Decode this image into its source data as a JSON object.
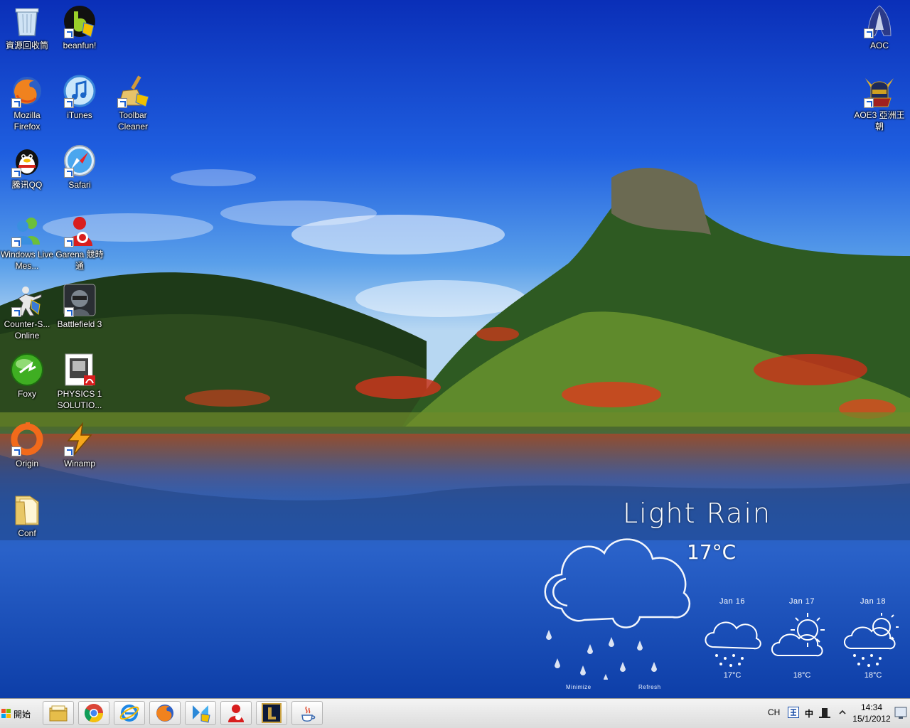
{
  "desktop": {
    "icons": [
      {
        "label": "資源回收筒",
        "icon": "recycle-bin-icon"
      },
      {
        "label": "beanfun!",
        "icon": "beanfun-icon"
      },
      {
        "label": "Mozilla Firefox",
        "icon": "firefox-icon"
      },
      {
        "label": "iTunes",
        "icon": "itunes-icon"
      },
      {
        "label": "Toolbar Cleaner",
        "icon": "toolbar-cleaner-icon"
      },
      {
        "label": "騰讯QQ",
        "icon": "qq-icon"
      },
      {
        "label": "Safari",
        "icon": "safari-icon"
      },
      {
        "label": "Windows Live Mes...",
        "icon": "windows-live-messenger-icon"
      },
      {
        "label": "Garena 競時通",
        "icon": "garena-icon"
      },
      {
        "label": "Counter-S... Online",
        "icon": "counter-strike-icon"
      },
      {
        "label": "Battlefield 3",
        "icon": "battlefield3-icon"
      },
      {
        "label": "Foxy",
        "icon": "foxy-icon"
      },
      {
        "label": "PHYSICS 1 SOLUTIO...",
        "icon": "pdf-icon"
      },
      {
        "label": "Origin",
        "icon": "origin-icon"
      },
      {
        "label": "Winamp",
        "icon": "winamp-icon"
      },
      {
        "label": "Conf",
        "icon": "folder-icon"
      },
      {
        "label": "AOC",
        "icon": "aoc-icon"
      },
      {
        "label": "AOE3 亞洲王朝",
        "icon": "aoe3-icon"
      }
    ]
  },
  "weather": {
    "condition": "Light Rain",
    "temperature": "17°C",
    "minimize_label": "Minimize",
    "refresh_label": "Refresh",
    "forecast": [
      {
        "date": "Jan 16",
        "temp": "17°C",
        "icon": "rain-cloud-icon"
      },
      {
        "date": "Jan 17",
        "temp": "18°C",
        "icon": "sun-cloud-icon"
      },
      {
        "date": "Jan 18",
        "temp": "18°C",
        "icon": "sun-rain-cloud-icon"
      }
    ]
  },
  "taskbar": {
    "start_label": "開始",
    "pinned": [
      {
        "icon": "explorer-folder-icon"
      },
      {
        "icon": "chrome-icon"
      },
      {
        "icon": "internet-explorer-icon"
      },
      {
        "icon": "firefox-icon"
      },
      {
        "icon": "app-blue-icon"
      },
      {
        "icon": "garena-icon"
      },
      {
        "icon": "league-of-legends-icon"
      },
      {
        "icon": "java-icon"
      }
    ],
    "tray": {
      "lang": "CH",
      "ime": "中",
      "time": "14:34",
      "date": "15/1/2012"
    }
  }
}
